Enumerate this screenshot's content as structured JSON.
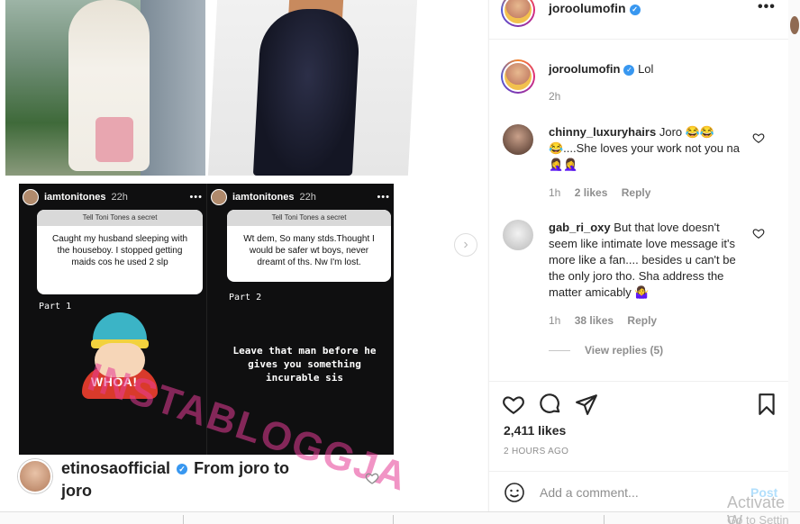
{
  "post": {
    "author": "joroolumofin",
    "more_label": "•••"
  },
  "media": {
    "story1": {
      "username": "iamtonitones",
      "time": "22h",
      "dots": "•••",
      "question_title": "Tell Toni Tones a secret",
      "question_text": "Caught my husband sleeping with the houseboy. I stopped getting maids cos he used 2 slp",
      "part": "Part 1",
      "sticker_text": "WHOA!"
    },
    "story2": {
      "username": "iamtonitones",
      "time": "22h",
      "dots": "•••",
      "question_title": "Tell Toni Tones a secret",
      "question_text": "Wt dem, So many stds.Thought I would be safer wt boys, never dreamt of ths. Nw I'm lost.",
      "part": "Part 2",
      "reply_text": "Leave that man before he gives you something incurable sis"
    },
    "watermark": "INSTABLOGGJA",
    "caption": {
      "username": "etinosaofficial",
      "text_line1": "From joro to",
      "text_line2": "joro"
    },
    "next_label": "›"
  },
  "comments": [
    {
      "username": "joroolumofin",
      "text": "Lol",
      "time": "2h"
    },
    {
      "username": "chinny_luxuryhairs",
      "text": "Joro 😂😂😂....She loves your work not you na 🤦‍♀️🤦‍♀️",
      "time": "1h",
      "likes": "2 likes",
      "reply": "Reply"
    },
    {
      "username": "gab_ri_oxy",
      "text": "But that love doesn't seem like intimate love message it's more like a fan.... besides u can't be the only joro tho. Sha address the matter amicably 🤷‍♀️",
      "time": "1h",
      "likes": "38 likes",
      "reply": "Reply",
      "view_replies": "View replies (5)"
    }
  ],
  "footer": {
    "likes": "2,411 likes",
    "ago": "2 HOURS AGO",
    "add_comment_placeholder": "Add a comment...",
    "post_label": "Post"
  },
  "overlay": {
    "activate": "Activate W",
    "goto": "Go to Settin"
  },
  "colors": {
    "verified": "#3897f0",
    "post_disabled": "#b2dffc",
    "muted": "#8e8e8e"
  }
}
